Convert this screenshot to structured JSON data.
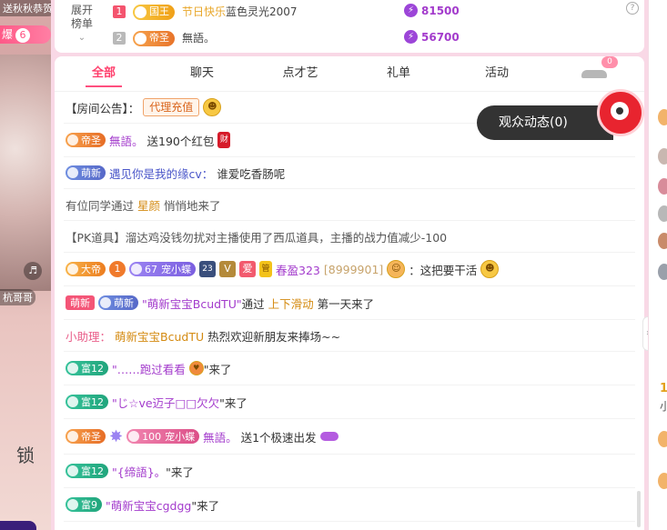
{
  "stream": {
    "top_tag": "送秋秋恭贺",
    "burst_label": "爆",
    "burst_count": "6",
    "host_tag": "杭哥哥",
    "sticker_text": "锁",
    "volume_icon": "speaker-icon"
  },
  "rank": {
    "expand_label": "展开",
    "expand_label2": "榜单",
    "help_icon": "?",
    "rows": [
      {
        "idx": "1",
        "badge": "国王",
        "gift_tag": "节日快乐",
        "name": "蓝色灵光2007",
        "points": "81500"
      },
      {
        "idx": "2",
        "badge": "帝圣",
        "name": "無語。",
        "points": "56700"
      }
    ]
  },
  "tabs": [
    {
      "label": "全部"
    },
    {
      "label": "聊天"
    },
    {
      "label": "点才艺"
    },
    {
      "label": "礼单"
    },
    {
      "label": "活动"
    }
  ],
  "car_count": "0",
  "viewer_button": "观众动态(0)",
  "messages": {
    "m1": {
      "prefix": "【房间公告】：",
      "tag": "代理充值"
    },
    "m2": {
      "badge": "帝圣",
      "user": "無語。",
      "text": "送190个红包",
      "gift": "财"
    },
    "m3": {
      "badge": "萌新",
      "user": "遇见你是我的缘cv：",
      "text": "谁爱吃香肠呢"
    },
    "m4": {
      "pre": "有位同学通过",
      "via": "星颜",
      "post": "悄悄地来了"
    },
    "m5": {
      "text": "【PK道具】溜达鸡没钱勿扰对主播使用了西瓜道具，主播的战力值减少-100"
    },
    "m6": {
      "da": "大帝",
      "lv1": "1",
      "pet_lv": "67",
      "pet": "宠小蝶",
      "guard_lv": "23",
      "ai": "爱",
      "guan": "管",
      "user": "春盈323",
      "uid": "[8999901]",
      "text": "：这把要干活"
    },
    "m7": {
      "tag1": "萌新",
      "tag2": "萌新",
      "user": "\"萌新宝宝BcudTU\"",
      "pre": "通过",
      "via": "上下滑动",
      "post": "第一天来了"
    },
    "m8": {
      "helper": "小助理：",
      "user": "萌新宝宝BcudTU",
      "text": "热烈欢迎新朋友来捧场~~"
    },
    "m9": {
      "badge": "富12",
      "user": "\"……跑过看看",
      "post": "\"来了"
    },
    "m10": {
      "badge": "富12",
      "user": "\"じ☆ve迈子□□欠欠",
      "post": "\"来了"
    },
    "m11": {
      "badge": "帝圣",
      "pet_lv": "100",
      "pet": "宠小蝶",
      "user": "無語。",
      "text": "送1个极速出发"
    },
    "m12": {
      "badge": "富12",
      "user": "\"{缔語}。",
      "post": "\"来了"
    },
    "m13": {
      "badge": "富9",
      "user": "\"萌新宝宝cgdgg",
      "post": "\"来了"
    }
  },
  "right_panel": {
    "num": "1",
    "small": "小"
  }
}
